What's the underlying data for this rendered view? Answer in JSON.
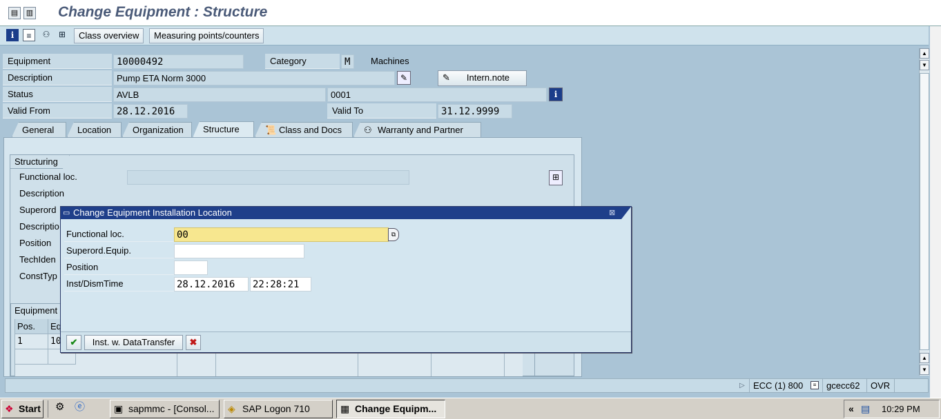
{
  "window": {
    "title": "Change Equipment : Structure"
  },
  "toolbar": {
    "class_overview": "Class overview",
    "measuring_points": "Measuring points/counters"
  },
  "header": {
    "equipment_label": "Equipment",
    "equipment_value": "10000492",
    "category_label": "Category",
    "category_value": "M",
    "category_text": "Machines",
    "description_label": "Description",
    "description_value": "Pump ETA Norm 3000",
    "intern_note": "Intern.note",
    "status_label": "Status",
    "status_value": "AVLB",
    "status_value2": "0001",
    "valid_from_label": "Valid From",
    "valid_from_value": "28.12.2016",
    "valid_to_label": "Valid To",
    "valid_to_value": "31.12.9999"
  },
  "tabs": [
    {
      "label": "General"
    },
    {
      "label": "Location"
    },
    {
      "label": "Organization"
    },
    {
      "label": "Structure"
    },
    {
      "label": "Class and Docs"
    },
    {
      "label": "Warranty and Partner"
    }
  ],
  "structuring": {
    "title": "Structuring",
    "labels": [
      "Functional loc.",
      "Description",
      "Superord",
      "Descriptio",
      "Position",
      "TechIden",
      "ConstTyp"
    ]
  },
  "equipment_table": {
    "title": "Equipment",
    "columns": [
      "Pos.",
      "Eq"
    ],
    "rows": [
      [
        "1",
        "10"
      ]
    ]
  },
  "dialog": {
    "title": "Change Equipment Installation Location",
    "functional_loc_label": "Functional loc.",
    "functional_loc_value": "00",
    "superord_label": "Superord.Equip.",
    "superord_value": "",
    "position_label": "Position",
    "position_value": "",
    "inst_label": "Inst/DismTime",
    "inst_date": "28.12.2016",
    "inst_time": "22:28:21",
    "transfer_button": "Inst. w. DataTransfer"
  },
  "statusbar": {
    "system": "ECC (1) 800",
    "server": "gcecc62",
    "mode": "OVR"
  },
  "taskbar": {
    "start": "Start",
    "tasks": [
      "sapmmc - [Consol...",
      "SAP Logon 710",
      "Change Equipm..."
    ],
    "clock": "10:29 PM",
    "chevron": "«"
  },
  "colors": {
    "accent": "#1f3f8a",
    "highlight_field": "#f7e78f",
    "background": "#aac4d6"
  }
}
